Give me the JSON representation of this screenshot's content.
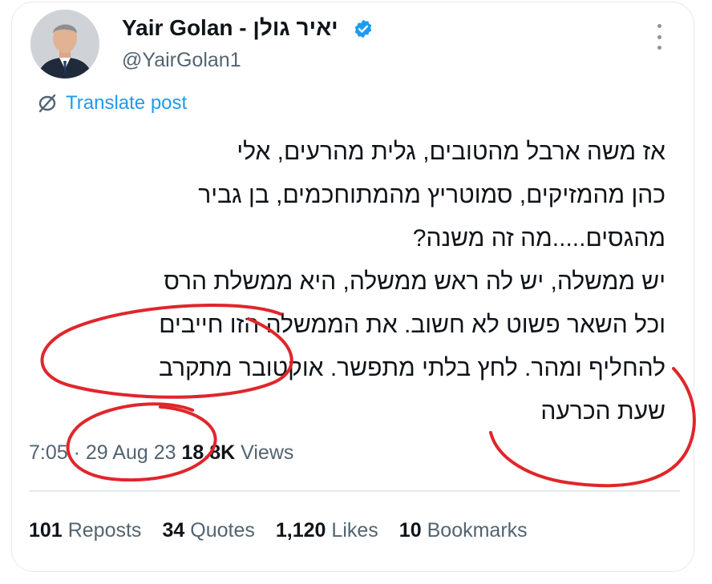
{
  "author": {
    "display_name": "Yair Golan - יאיר גולן",
    "handle": "@YairGolan1",
    "verified": true
  },
  "translate": {
    "label": "Translate post",
    "icon": "globe-slash-icon"
  },
  "tweet": {
    "text": "אז משה ארבל מהטובים, גלית מהרעים, אלי\nכהן מהמזיקים, סמוטריץ מהמתוחכמים, בן גביר\nמהגסים.....מה זה משנה?\nיש ממשלה, יש לה ראש ממשלה, היא ממשלת הרס\nוכל השאר פשוט לא חשוב. את הממשלה הזו חייבים\nלהחליף ומהר. לחץ בלתי מתפשר. אוקטובר מתקרב\nשעת הכרעה"
  },
  "meta": {
    "time": "7:05",
    "separator": " · ",
    "date": "29 Aug 23",
    "views_count": "18.8K",
    "views_label": "Views"
  },
  "stats": {
    "reposts_count": "101",
    "reposts_label": "Reposts",
    "quotes_count": "34",
    "quotes_label": "Quotes",
    "likes_count": "1,120",
    "likes_label": "Likes",
    "bookmarks_count": "10",
    "bookmarks_label": "Bookmarks"
  },
  "colors": {
    "link": "#1d9bf0",
    "verified_badge": "#1d9bf0",
    "secondary_text": "#536471",
    "annotation_red": "#e0262b"
  },
  "icons": [
    "verified-badge-icon",
    "more-options-icon",
    "globe-slash-icon"
  ]
}
